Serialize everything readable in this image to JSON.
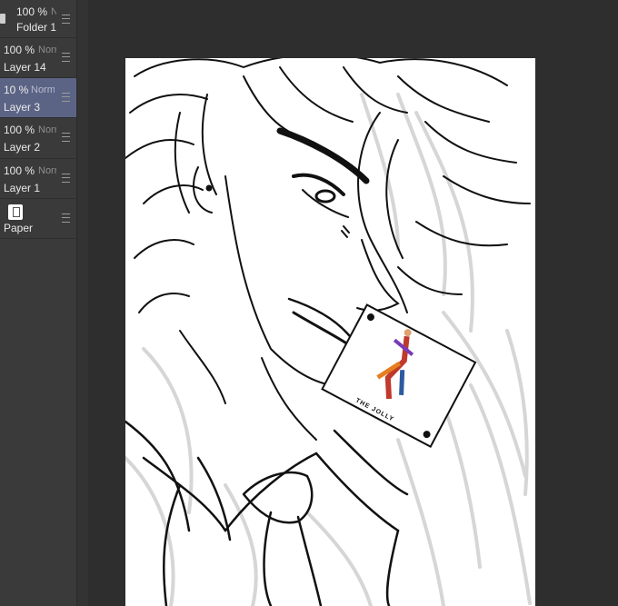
{
  "layers": [
    {
      "opacity": "100 %",
      "blend": "Normal",
      "name": "Folder 1"
    },
    {
      "opacity": "100 %",
      "blend": "Normal",
      "name": "Layer 14"
    },
    {
      "opacity": "10 %",
      "blend": "Normal",
      "name": "Layer 3",
      "selected": true
    },
    {
      "opacity": "100 %",
      "blend": "Normal",
      "name": "Layer 2"
    },
    {
      "opacity": "100 %",
      "blend": "Normal",
      "name": "Layer 1"
    },
    {
      "opacity": "",
      "blend": "",
      "name": "Paper"
    }
  ],
  "artwork": {
    "card_text": "THE JOLLY"
  },
  "colors": {
    "panel": "#3a3a3a",
    "selected_row": "#5c6485",
    "workspace": "#2e2e2e",
    "paper": "#ffffff"
  }
}
